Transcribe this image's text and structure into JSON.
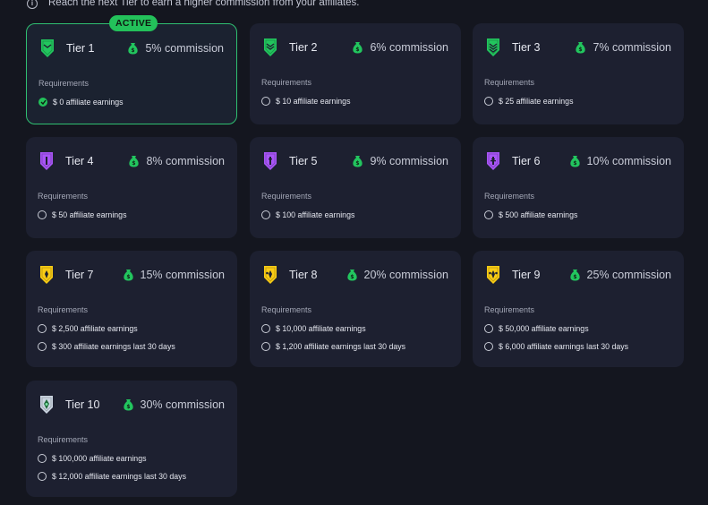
{
  "notice": {
    "text": "Reach the next Tier to earn a higher commission from your affiliates."
  },
  "active_label": "ACTIVE",
  "requirements_label": "Requirements",
  "tiers": [
    {
      "name": "Tier 1",
      "commission": "5% commission",
      "reqs": [
        "$ 0 affiliate earnings"
      ],
      "met": [
        true
      ],
      "badge_color": "#22c55e"
    },
    {
      "name": "Tier 2",
      "commission": "6% commission",
      "reqs": [
        "$ 10 affiliate earnings"
      ],
      "met": [
        false
      ],
      "badge_color": "#22c55e"
    },
    {
      "name": "Tier 3",
      "commission": "7% commission",
      "reqs": [
        "$ 25 affiliate earnings"
      ],
      "met": [
        false
      ],
      "badge_color": "#22c55e"
    },
    {
      "name": "Tier 4",
      "commission": "8% commission",
      "reqs": [
        "$ 50 affiliate earnings"
      ],
      "met": [
        false
      ],
      "badge_color": "#a855f7"
    },
    {
      "name": "Tier 5",
      "commission": "9% commission",
      "reqs": [
        "$ 100 affiliate earnings"
      ],
      "met": [
        false
      ],
      "badge_color": "#a855f7"
    },
    {
      "name": "Tier 6",
      "commission": "10% commission",
      "reqs": [
        "$ 500 affiliate earnings"
      ],
      "met": [
        false
      ],
      "badge_color": "#a855f7"
    },
    {
      "name": "Tier 7",
      "commission": "15% commission",
      "reqs": [
        "$ 2,500 affiliate earnings",
        "$ 300 affiliate earnings last 30 days"
      ],
      "met": [
        false,
        false
      ],
      "badge_color": "#facc15"
    },
    {
      "name": "Tier 8",
      "commission": "20% commission",
      "reqs": [
        "$ 10,000 affiliate earnings",
        "$ 1,200 affiliate earnings last 30 days"
      ],
      "met": [
        false,
        false
      ],
      "badge_color": "#facc15"
    },
    {
      "name": "Tier 9",
      "commission": "25% commission",
      "reqs": [
        "$ 50,000 affiliate earnings",
        "$ 6,000 affiliate earnings last 30 days"
      ],
      "met": [
        false,
        false
      ],
      "badge_color": "#facc15"
    },
    {
      "name": "Tier 10",
      "commission": "30% commission",
      "reqs": [
        "$ 100,000 affiliate earnings",
        "$ 12,000 affiliate earnings last 30 days"
      ],
      "met": [
        false,
        false
      ],
      "badge_color": "#cbd5e1"
    }
  ],
  "colors": {
    "accent": "#23c15a",
    "money_bag": "#22c55e",
    "card_bg": "#1d2030",
    "page_bg": "#14161f"
  }
}
